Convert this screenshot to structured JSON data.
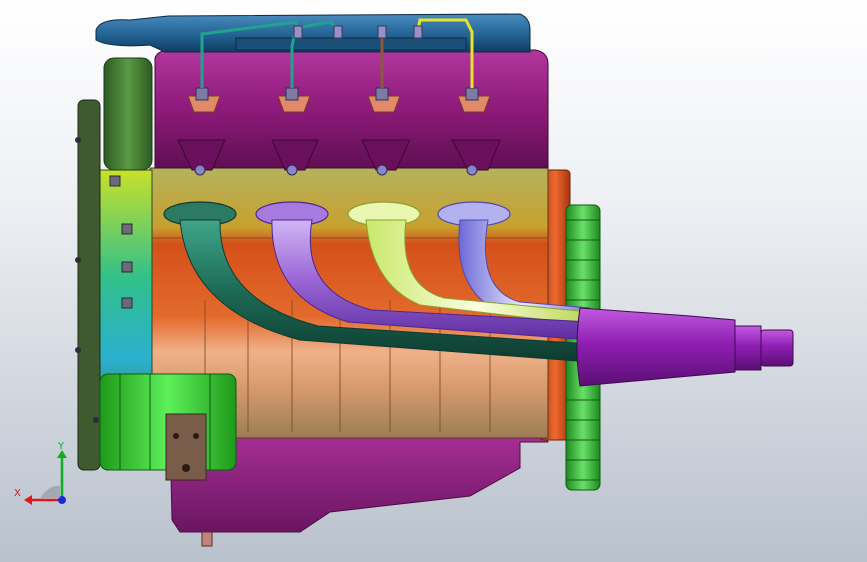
{
  "viewport": {
    "background_top": "#ffffff",
    "background_bottom": "#b9c1cc"
  },
  "triad": {
    "x_label": "X",
    "y_label": "Y",
    "x_color": "#e0161b",
    "y_color": "#0fae1f",
    "z_color": "#1a2bd6"
  },
  "model": {
    "colors": {
      "valve_cover": "#8e1a7a",
      "intake_plenum": "#1f5f8f",
      "block_upper": "#b5b35c",
      "block_middle": "#d4501a",
      "block_lower": "#e7a97e",
      "oil_pan": "#8a1f7e",
      "flywheel": "#3fbf3a",
      "runner_1": "#1d6a55",
      "runner_2": "#9a66d6",
      "runner_3": "#e7f5a2",
      "runner_4": "#a6a3e8",
      "collector": "#8f1fb3",
      "timing_cover": "#3f7a2e",
      "water_pump": "#3fd43a",
      "bellhousing": "#e0521d",
      "wire_1": "#1fa38f",
      "wire_2": "#1fa38f",
      "wire_3": "#8a5a3c",
      "wire_4": "#e8e32a"
    }
  }
}
